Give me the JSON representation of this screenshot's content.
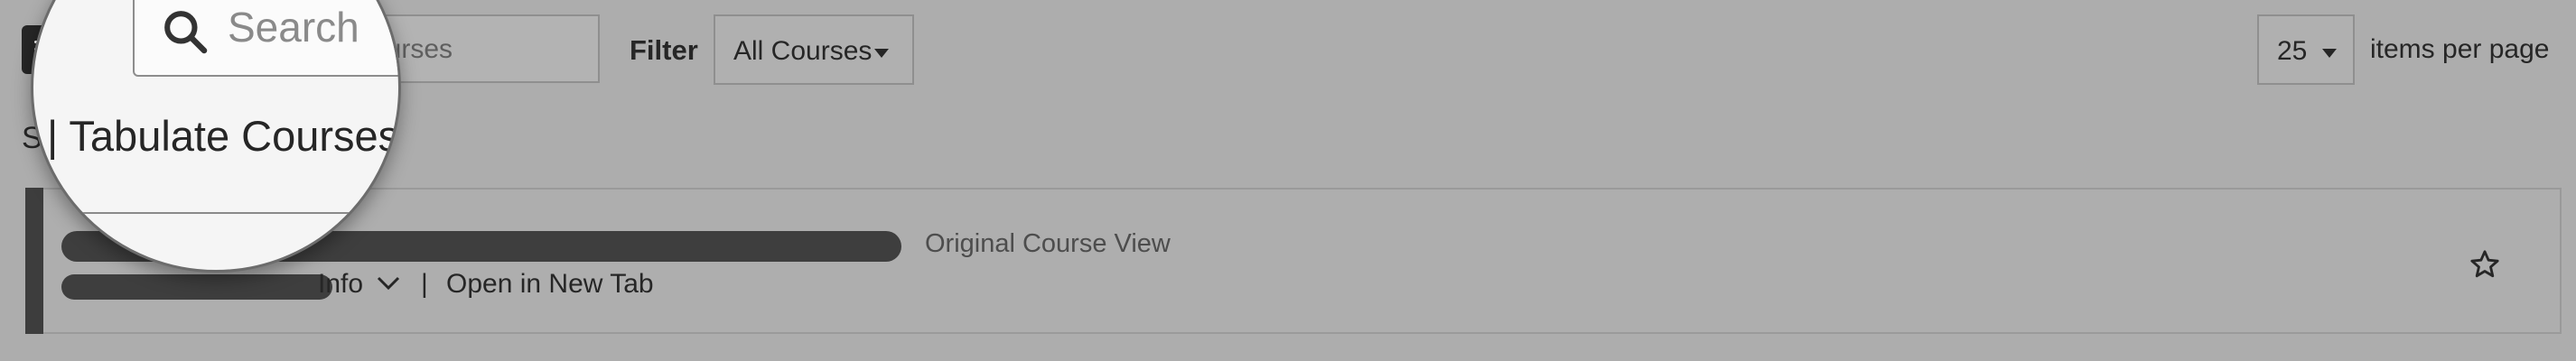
{
  "toolbar": {
    "search_placeholder": "Search courses",
    "search_visible_fragment": "courses",
    "filter_label": "Filter",
    "filter_value": "All Courses",
    "per_page_value": "25",
    "per_page_label": "items per page"
  },
  "course_list": {
    "partial_label": "S",
    "course": {
      "view_type": "Original Course View",
      "info_label": "Info",
      "separator": "|",
      "open_new_tab_label": "Open in New Tab"
    }
  },
  "magnifier": {
    "search_placeholder": "Search",
    "heading": "| Tabulate Courses"
  },
  "colors": {
    "page_background": "#adadad",
    "menu_button": "#262626",
    "card_stripe": "#3d3d3d",
    "redaction_bar": "#3e3e3e"
  },
  "icons": [
    "menu-icon",
    "search-icon",
    "chevron-down-icon",
    "star-icon",
    "caret-down-icon"
  ]
}
